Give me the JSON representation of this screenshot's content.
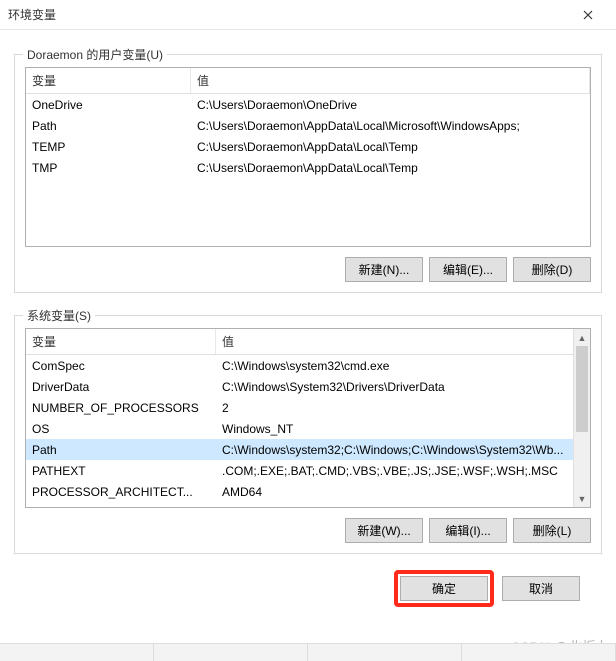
{
  "window": {
    "title": "环境变量"
  },
  "user_section": {
    "legend": "Doraemon 的用户变量(U)",
    "col_name": "变量",
    "col_value": "值",
    "rows": [
      {
        "name": "OneDrive",
        "value": "C:\\Users\\Doraemon\\OneDrive"
      },
      {
        "name": "Path",
        "value": "C:\\Users\\Doraemon\\AppData\\Local\\Microsoft\\WindowsApps;"
      },
      {
        "name": "TEMP",
        "value": "C:\\Users\\Doraemon\\AppData\\Local\\Temp"
      },
      {
        "name": "TMP",
        "value": "C:\\Users\\Doraemon\\AppData\\Local\\Temp"
      }
    ],
    "buttons": {
      "new": "新建(N)...",
      "edit": "编辑(E)...",
      "delete": "删除(D)"
    }
  },
  "system_section": {
    "legend": "系统变量(S)",
    "col_name": "变量",
    "col_value": "值",
    "rows": [
      {
        "name": "ComSpec",
        "value": "C:\\Windows\\system32\\cmd.exe"
      },
      {
        "name": "DriverData",
        "value": "C:\\Windows\\System32\\Drivers\\DriverData"
      },
      {
        "name": "NUMBER_OF_PROCESSORS",
        "value": "2"
      },
      {
        "name": "OS",
        "value": "Windows_NT"
      },
      {
        "name": "Path",
        "value": "C:\\Windows\\system32;C:\\Windows;C:\\Windows\\System32\\Wb..."
      },
      {
        "name": "PATHEXT",
        "value": ".COM;.EXE;.BAT;.CMD;.VBS;.VBE;.JS;.JSE;.WSF;.WSH;.MSC"
      },
      {
        "name": "PROCESSOR_ARCHITECT...",
        "value": "AMD64"
      }
    ],
    "selected_index": 4,
    "buttons": {
      "new": "新建(W)...",
      "edit": "编辑(I)...",
      "delete": "删除(L)"
    }
  },
  "footer": {
    "ok": "确定",
    "cancel": "取消"
  },
  "watermark": "CSDN @北栀九"
}
